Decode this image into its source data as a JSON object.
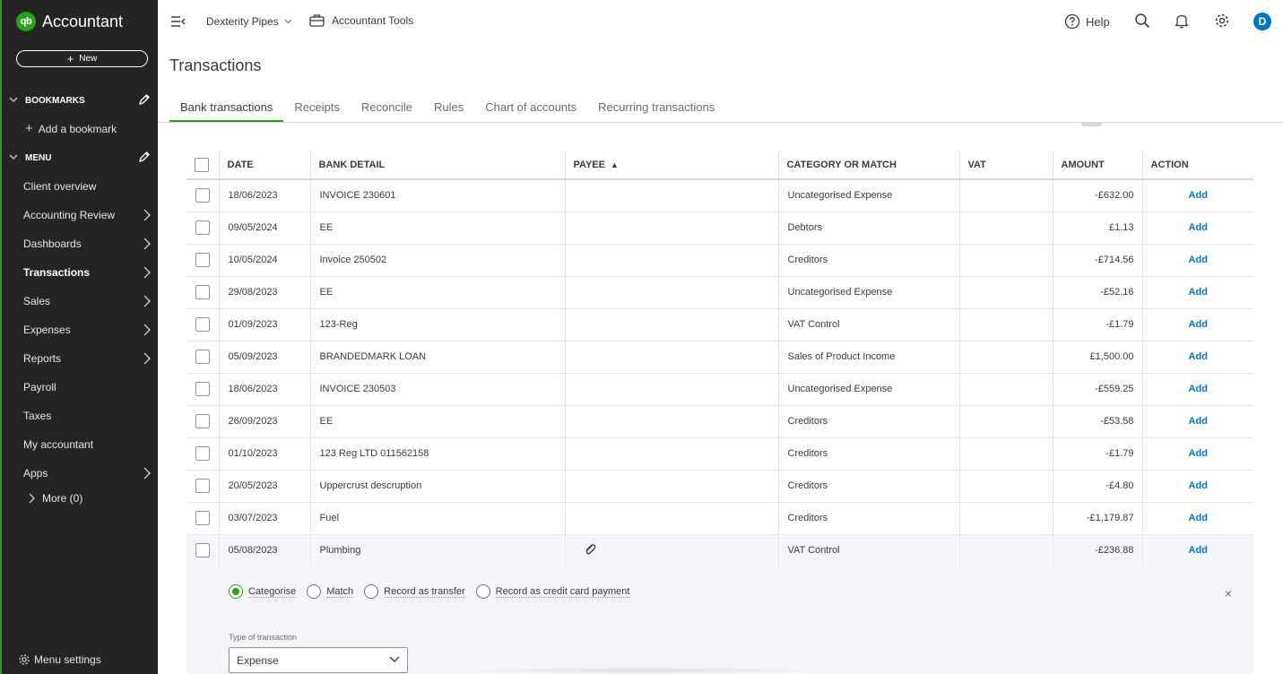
{
  "brand": {
    "logo": "qb",
    "name": "Accountant"
  },
  "sidebar": {
    "new_label": "New",
    "bookmarks_heading": "BOOKMARKS",
    "add_bookmark": "Add a bookmark",
    "menu_heading": "MENU",
    "items": [
      {
        "label": "Client overview",
        "arrow": false
      },
      {
        "label": "Accounting Review",
        "arrow": true
      },
      {
        "label": "Dashboards",
        "arrow": true
      },
      {
        "label": "Transactions",
        "arrow": true,
        "active": true
      },
      {
        "label": "Sales",
        "arrow": true
      },
      {
        "label": "Expenses",
        "arrow": true
      },
      {
        "label": "Reports",
        "arrow": true
      },
      {
        "label": "Payroll",
        "arrow": false
      },
      {
        "label": "Taxes",
        "arrow": false
      },
      {
        "label": "My accountant",
        "arrow": false
      },
      {
        "label": "Apps",
        "arrow": true
      }
    ],
    "more_label": "More (0)",
    "menu_settings": "Menu settings"
  },
  "topbar": {
    "company": "Dexterity Pipes",
    "accountant_tools": "Accountant Tools",
    "help": "Help",
    "avatar_initial": "D"
  },
  "page_title": "Transactions",
  "tabs": [
    "Bank transactions",
    "Receipts",
    "Reconcile",
    "Rules",
    "Chart of accounts",
    "Recurring transactions"
  ],
  "table": {
    "headers": {
      "date": "DATE",
      "bank_detail": "BANK DETAIL",
      "payee": "PAYEE",
      "category": "CATEGORY OR MATCH",
      "vat": "VAT",
      "amount": "AMOUNT",
      "action": "ACTION"
    },
    "rows": [
      {
        "date": "18/06/2023",
        "detail": "INVOICE 230601",
        "payee": "",
        "category": "Uncategorised Expense",
        "vat": "",
        "amount": "-£632.00",
        "action": "Add"
      },
      {
        "date": "09/05/2024",
        "detail": "EE",
        "payee": "",
        "category": "Debtors",
        "vat": "",
        "amount": "£1.13",
        "action": "Add"
      },
      {
        "date": "10/05/2024",
        "detail": "Invoice 250502",
        "payee": "",
        "category": "Creditors",
        "vat": "",
        "amount": "-£714.56",
        "action": "Add"
      },
      {
        "date": "29/08/2023",
        "detail": "EE",
        "payee": "",
        "category": "Uncategorised Expense",
        "vat": "",
        "amount": "-£52.16",
        "action": "Add"
      },
      {
        "date": "01/09/2023",
        "detail": "123-Reg",
        "payee": "",
        "category": "VAT Control",
        "vat": "",
        "amount": "-£1.79",
        "action": "Add"
      },
      {
        "date": "05/09/2023",
        "detail": "BRANDEDMARK LOAN",
        "payee": "",
        "category": "Sales of Product Income",
        "vat": "",
        "amount": "£1,500.00",
        "action": "Add"
      },
      {
        "date": "18/06/2023",
        "detail": "INVOICE 230503",
        "payee": "",
        "category": "Uncategorised Expense",
        "vat": "",
        "amount": "-£559.25",
        "action": "Add"
      },
      {
        "date": "26/09/2023",
        "detail": "EE",
        "payee": "",
        "category": "Creditors",
        "vat": "",
        "amount": "-£53.58",
        "action": "Add"
      },
      {
        "date": "01/10/2023",
        "detail": "123 Reg LTD 011562158",
        "payee": "",
        "category": "Creditors",
        "vat": "",
        "amount": "-£1.79",
        "action": "Add"
      },
      {
        "date": "20/05/2023",
        "detail": "Uppercrust descruption",
        "payee": "",
        "category": "Creditors",
        "vat": "",
        "amount": "-£4.80",
        "action": "Add"
      },
      {
        "date": "03/07/2023",
        "detail": "Fuel",
        "payee": "",
        "category": "Creditors",
        "vat": "",
        "amount": "-£1,179.87",
        "action": "Add"
      },
      {
        "date": "05/08/2023",
        "detail": "Plumbing",
        "payee": "",
        "category": "VAT Control",
        "vat": "",
        "amount": "-£236.88",
        "action": "Add",
        "attachment": true,
        "expanded": true
      }
    ]
  },
  "panel": {
    "options": [
      "Categorise",
      "Match",
      "Record as transfer",
      "Record as credit card payment"
    ],
    "selected": "Categorise",
    "close": "×",
    "type_label": "Type of transaction",
    "type_value": "Expense"
  },
  "colors": {
    "brand_green": "#2ca01c",
    "link_blue": "#0077c5",
    "sidebar_bg": "#242424"
  }
}
